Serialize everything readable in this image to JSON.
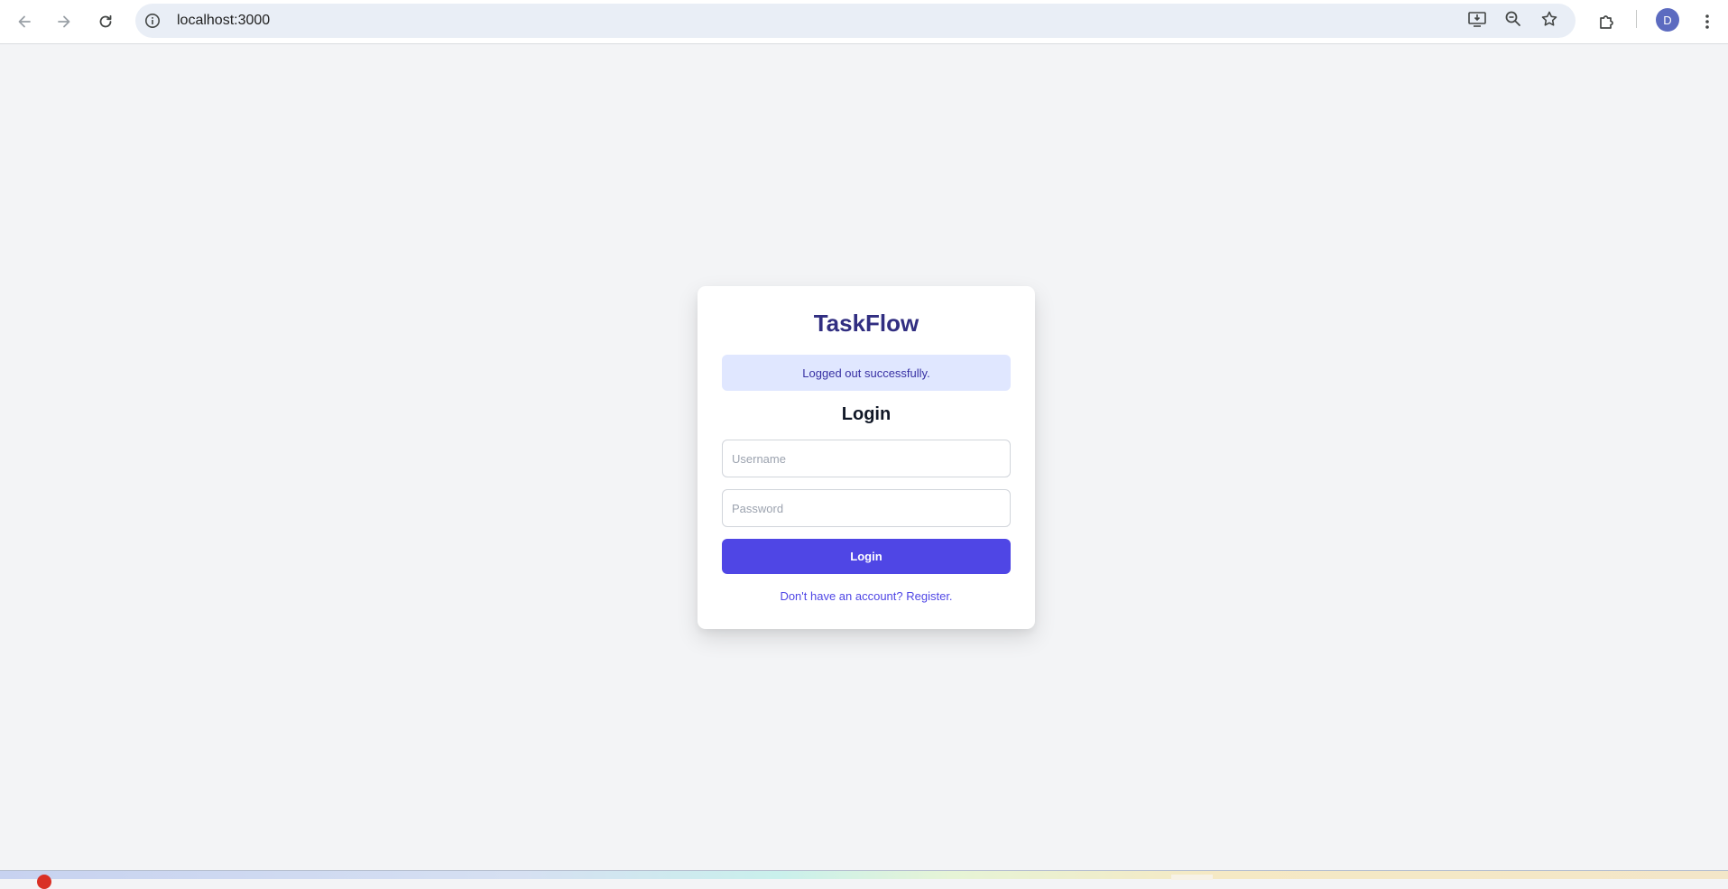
{
  "browser": {
    "url": "localhost:3000",
    "profile_initial": "D",
    "icons": {
      "back": "back-arrow-icon",
      "forward": "forward-arrow-icon",
      "reload": "reload-icon",
      "site_info": "info-icon",
      "install": "install-app-icon",
      "zoom": "zoom-icon",
      "bookmark": "star-icon",
      "extensions": "puzzle-icon",
      "menu": "kebab-menu-icon"
    }
  },
  "login_card": {
    "brand": "TaskFlow",
    "alert_message": "Logged out successfully.",
    "title": "Login",
    "username_placeholder": "Username",
    "password_placeholder": "Password",
    "submit_label": "Login",
    "register_link": "Don't have an account? Register."
  },
  "colors": {
    "page_background": "#f3f4f6",
    "brand_text": "#312e81",
    "primary": "#4f46e5",
    "alert_background": "#e0e7ff",
    "alert_text": "#3730a3"
  }
}
